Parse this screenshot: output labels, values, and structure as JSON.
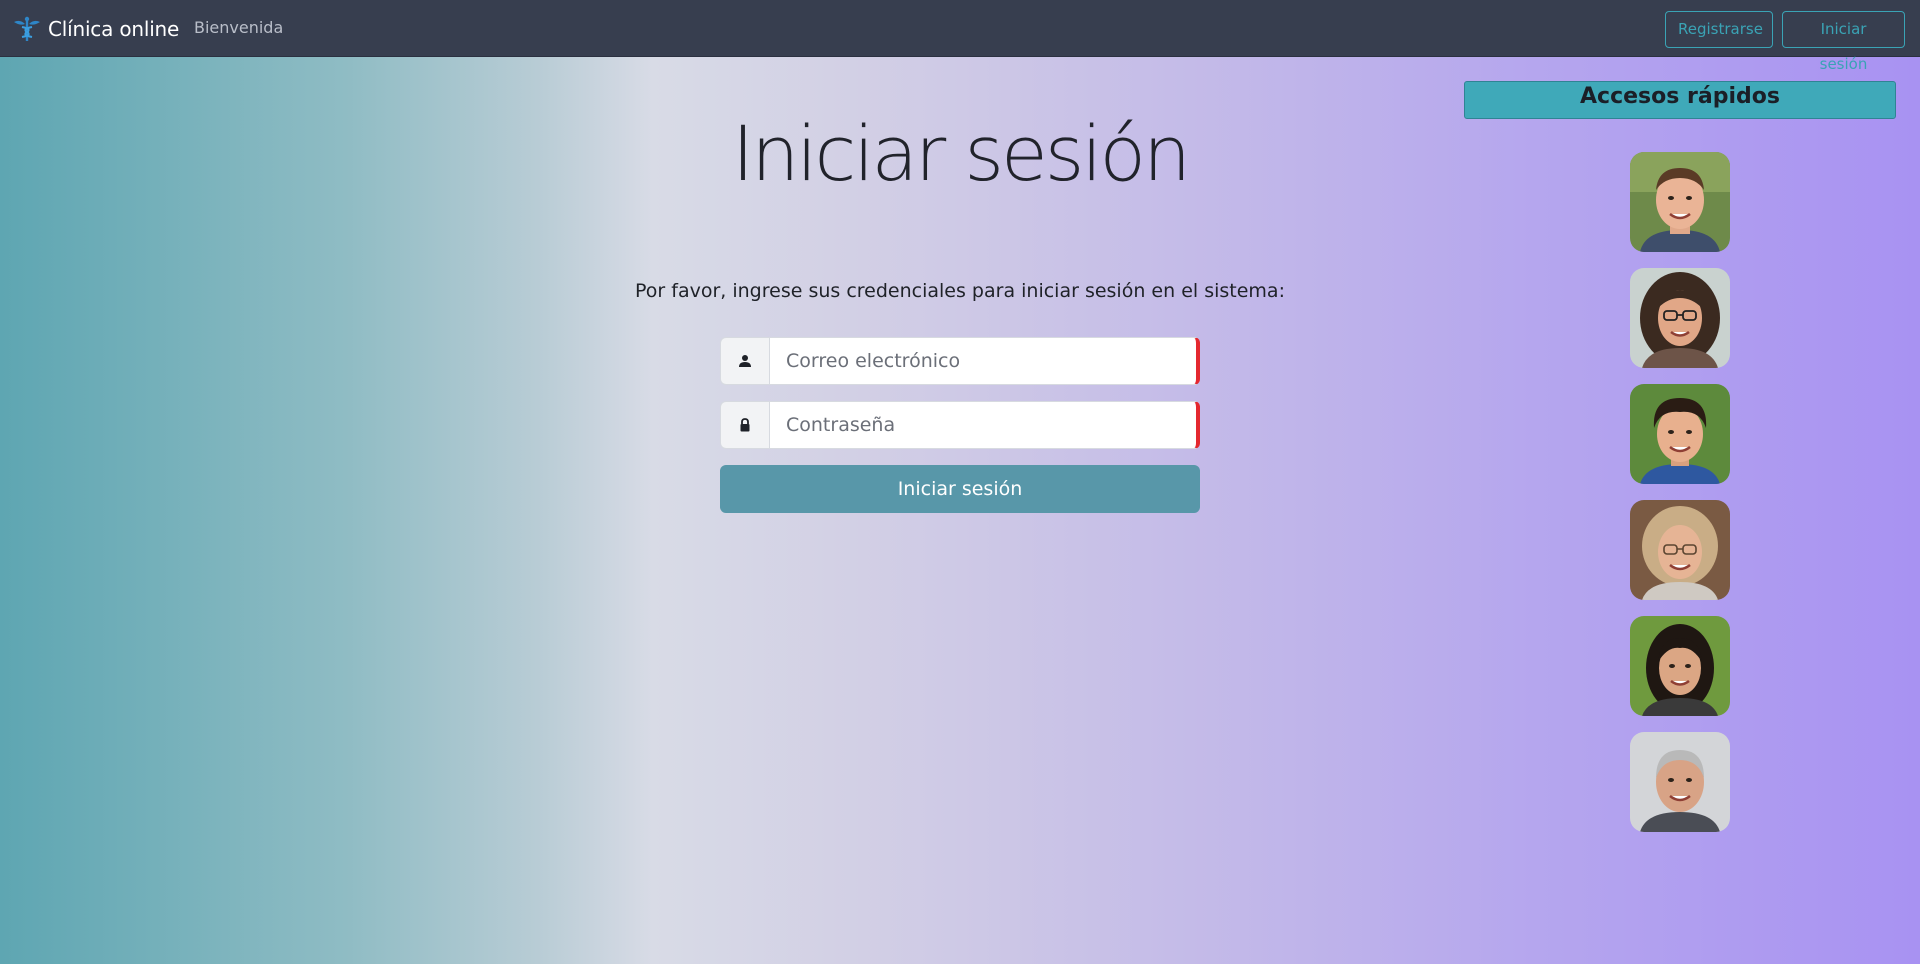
{
  "navbar": {
    "brand": "Clínica online",
    "brand_icon": "caduceus-icon",
    "link": "Bienvenida",
    "register": "Registrarse",
    "login": "Iniciar sesión"
  },
  "main": {
    "title": "Iniciar sesión",
    "instructions": "Por favor, ingrese sus credenciales para iniciar sesión en el sistema:",
    "email_placeholder": "Correo electrónico",
    "password_placeholder": "Contraseña",
    "submit": "Iniciar sesión"
  },
  "quick_access": {
    "title": "Accesos rápidos",
    "users": [
      {
        "avatar": "man-short-brown-hair"
      },
      {
        "avatar": "woman-glasses-curly-hair"
      },
      {
        "avatar": "young-man-dark-hair"
      },
      {
        "avatar": "older-woman-glasses"
      },
      {
        "avatar": "woman-dark-hair"
      },
      {
        "avatar": "older-man-gray-hair"
      }
    ]
  },
  "colors": {
    "navbar_bg": "#373e4f",
    "accent": "#3aa3b5",
    "submit_bg": "#5897a9",
    "invalid_border": "#e4282f",
    "quick_header_bg": "#3fa9b9"
  }
}
